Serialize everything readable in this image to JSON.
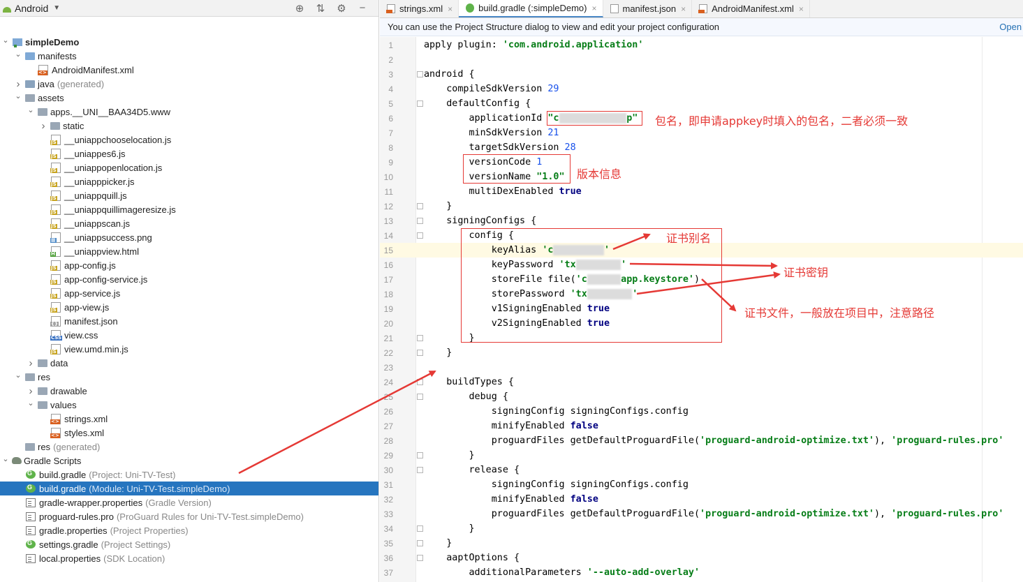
{
  "project_panel": {
    "view_label": "Android",
    "tree": [
      {
        "depth": 0,
        "caret": "down",
        "icon": "module",
        "label": "simpleDemo",
        "bold": true
      },
      {
        "depth": 1,
        "caret": "down",
        "icon": "folder-blue",
        "label": "manifests"
      },
      {
        "depth": 2,
        "caret": "",
        "icon": "file-xml",
        "label": "AndroidManifest.xml"
      },
      {
        "depth": 1,
        "caret": "right",
        "icon": "folder-java",
        "label": "java",
        "hint": "(generated)"
      },
      {
        "depth": 1,
        "caret": "down",
        "icon": "folder",
        "label": "assets"
      },
      {
        "depth": 2,
        "caret": "down",
        "icon": "folder",
        "label": "apps.__UNI__BAA34D5.www"
      },
      {
        "depth": 3,
        "caret": "right",
        "icon": "folder",
        "label": "static"
      },
      {
        "depth": 3,
        "caret": "",
        "icon": "file-js",
        "label": "__uniappchooselocation.js"
      },
      {
        "depth": 3,
        "caret": "",
        "icon": "file-js",
        "label": "__uniappes6.js"
      },
      {
        "depth": 3,
        "caret": "",
        "icon": "file-js",
        "label": "__uniappopenlocation.js"
      },
      {
        "depth": 3,
        "caret": "",
        "icon": "file-js",
        "label": "__uniapppicker.js"
      },
      {
        "depth": 3,
        "caret": "",
        "icon": "file-js",
        "label": "__uniappquill.js"
      },
      {
        "depth": 3,
        "caret": "",
        "icon": "file-js",
        "label": "__uniappquillimageresize.js"
      },
      {
        "depth": 3,
        "caret": "",
        "icon": "file-js",
        "label": "__uniappscan.js"
      },
      {
        "depth": 3,
        "caret": "",
        "icon": "file-img",
        "label": "__uniappsuccess.png"
      },
      {
        "depth": 3,
        "caret": "",
        "icon": "file-html",
        "label": "__uniappview.html"
      },
      {
        "depth": 3,
        "caret": "",
        "icon": "file-js",
        "label": "app-config.js"
      },
      {
        "depth": 3,
        "caret": "",
        "icon": "file-js",
        "label": "app-config-service.js"
      },
      {
        "depth": 3,
        "caret": "",
        "icon": "file-js",
        "label": "app-service.js"
      },
      {
        "depth": 3,
        "caret": "",
        "icon": "file-js",
        "label": "app-view.js"
      },
      {
        "depth": 3,
        "caret": "",
        "icon": "file-json",
        "label": "manifest.json"
      },
      {
        "depth": 3,
        "caret": "",
        "icon": "file-css",
        "label": "view.css"
      },
      {
        "depth": 3,
        "caret": "",
        "icon": "file-js",
        "label": "view.umd.min.js"
      },
      {
        "depth": 2,
        "caret": "right",
        "icon": "folder",
        "label": "data"
      },
      {
        "depth": 1,
        "caret": "down",
        "icon": "folder",
        "label": "res"
      },
      {
        "depth": 2,
        "caret": "right",
        "icon": "folder",
        "label": "drawable"
      },
      {
        "depth": 2,
        "caret": "down",
        "icon": "folder",
        "label": "values"
      },
      {
        "depth": 3,
        "caret": "",
        "icon": "file-xml",
        "label": "strings.xml"
      },
      {
        "depth": 3,
        "caret": "",
        "icon": "file-xml",
        "label": "styles.xml"
      },
      {
        "depth": 1,
        "caret": "",
        "icon": "folder",
        "label": "res",
        "hint": "(generated)"
      },
      {
        "depth": 0,
        "caret": "down",
        "icon": "elephant",
        "label": "Gradle Scripts"
      },
      {
        "depth": 1,
        "caret": "",
        "icon": "gradle",
        "label": "build.gradle",
        "hint": "(Project: Uni-TV-Test)"
      },
      {
        "depth": 1,
        "caret": "",
        "icon": "gradle",
        "label": "build.gradle",
        "hint": "(Module: Uni-TV-Test.simpleDemo)",
        "selected": true
      },
      {
        "depth": 1,
        "caret": "",
        "icon": "props",
        "label": "gradle-wrapper.properties",
        "hint": "(Gradle Version)"
      },
      {
        "depth": 1,
        "caret": "",
        "icon": "props",
        "label": "proguard-rules.pro",
        "hint": "(ProGuard Rules for Uni-TV-Test.simpleDemo)"
      },
      {
        "depth": 1,
        "caret": "",
        "icon": "props",
        "label": "gradle.properties",
        "hint": "(Project Properties)"
      },
      {
        "depth": 1,
        "caret": "",
        "icon": "gradle",
        "label": "settings.gradle",
        "hint": "(Project Settings)"
      },
      {
        "depth": 1,
        "caret": "",
        "icon": "props",
        "label": "local.properties",
        "hint": "(SDK Location)"
      }
    ]
  },
  "editor": {
    "tabs": [
      {
        "label": "strings.xml",
        "icon": "xml",
        "active": false
      },
      {
        "label": "build.gradle (:simpleDemo)",
        "icon": "gradle",
        "active": true
      },
      {
        "label": "manifest.json",
        "icon": "json",
        "active": false
      },
      {
        "label": "AndroidManifest.xml",
        "icon": "xml",
        "active": false
      }
    ],
    "notice": "You can use the Project Structure dialog to view and edit your project configuration",
    "notice_link": "Open (",
    "current_line": 15,
    "lines": [
      [
        [
          "t",
          "apply plugin: "
        ],
        [
          "s",
          "'com.android.application'"
        ]
      ],
      [],
      [
        [
          "t",
          "android {"
        ]
      ],
      [
        [
          "t",
          "    compileSdkVersion "
        ],
        [
          "n",
          "29"
        ]
      ],
      [
        [
          "t",
          "    defaultConfig {"
        ]
      ],
      [
        [
          "t",
          "        applicationId "
        ],
        [
          "s",
          "\"c"
        ],
        [
          "b",
          "xxxxxxxxxxxx"
        ],
        [
          "s",
          "p\""
        ]
      ],
      [
        [
          "t",
          "        minSdkVersion "
        ],
        [
          "n",
          "21"
        ]
      ],
      [
        [
          "t",
          "        targetSdkVersion "
        ],
        [
          "n",
          "28"
        ]
      ],
      [
        [
          "t",
          "        versionCode "
        ],
        [
          "n",
          "1"
        ]
      ],
      [
        [
          "t",
          "        versionName "
        ],
        [
          "s",
          "\"1.0\""
        ]
      ],
      [
        [
          "t",
          "        multiDexEnabled "
        ],
        [
          "k",
          "true"
        ]
      ],
      [
        [
          "t",
          "    }"
        ]
      ],
      [
        [
          "t",
          "    signingConfigs {"
        ]
      ],
      [
        [
          "t",
          "        config {"
        ]
      ],
      [
        [
          "t",
          "            keyAlias "
        ],
        [
          "s",
          "'c"
        ],
        [
          "b",
          "kltestapp"
        ],
        [
          "s",
          "'"
        ]
      ],
      [
        [
          "t",
          "            keyPassword "
        ],
        [
          "s",
          "'tx"
        ],
        [
          "b",
          "_1658452"
        ],
        [
          "s",
          "'"
        ]
      ],
      [
        [
          "t",
          "            storeFile file("
        ],
        [
          "s",
          "'c"
        ],
        [
          "b",
          "kltest"
        ],
        [
          "s",
          "app.keystore'"
        ],
        [
          "t",
          ")"
        ]
      ],
      [
        [
          "t",
          "            storePassword "
        ],
        [
          "s",
          "'tx"
        ],
        [
          "b",
          "_1658452"
        ],
        [
          "s",
          "'"
        ]
      ],
      [
        [
          "t",
          "            v1SigningEnabled "
        ],
        [
          "k",
          "true"
        ]
      ],
      [
        [
          "t",
          "            v2SigningEnabled "
        ],
        [
          "k",
          "true"
        ]
      ],
      [
        [
          "t",
          "        }"
        ]
      ],
      [
        [
          "t",
          "    }"
        ]
      ],
      [],
      [
        [
          "t",
          "    buildTypes {"
        ]
      ],
      [
        [
          "t",
          "        debug {"
        ]
      ],
      [
        [
          "t",
          "            signingConfig signingConfigs.config"
        ]
      ],
      [
        [
          "t",
          "            minifyEnabled "
        ],
        [
          "k",
          "false"
        ]
      ],
      [
        [
          "t",
          "            proguardFiles getDefaultProguardFile("
        ],
        [
          "s",
          "'proguard-android-optimize.txt'"
        ],
        [
          "t",
          "), "
        ],
        [
          "s",
          "'proguard-rules.pro'"
        ]
      ],
      [
        [
          "t",
          "        }"
        ]
      ],
      [
        [
          "t",
          "        release {"
        ]
      ],
      [
        [
          "t",
          "            signingConfig signingConfigs.config"
        ]
      ],
      [
        [
          "t",
          "            minifyEnabled "
        ],
        [
          "k",
          "false"
        ]
      ],
      [
        [
          "t",
          "            proguardFiles getDefaultProguardFile("
        ],
        [
          "s",
          "'proguard-android-optimize.txt'"
        ],
        [
          "t",
          "), "
        ],
        [
          "s",
          "'proguard-rules.pro'"
        ]
      ],
      [
        [
          "t",
          "        }"
        ]
      ],
      [
        [
          "t",
          "    }"
        ]
      ],
      [
        [
          "t",
          "    aaptOptions {"
        ]
      ],
      [
        [
          "t",
          "        additionalParameters "
        ],
        [
          "s",
          "'--auto-add-overlay'"
        ]
      ]
    ],
    "fold_lines": [
      3,
      5,
      12,
      13,
      14,
      21,
      22,
      24,
      25,
      29,
      30,
      34,
      35,
      36
    ]
  },
  "annotations": {
    "package_name": "包名，即申请appkey时填入的包名，二者必须一致",
    "version_info": "版本信息",
    "cert_alias": "证书别名",
    "cert_key": "证书密钥",
    "cert_file": "证书文件，一般放在项目中，注意路径"
  },
  "colors": {
    "annotation_red": "#e53935",
    "selection_blue": "#2675bf",
    "string_green": "#067d17",
    "number_blue": "#1750eb",
    "keyword_navy": "#000080"
  }
}
